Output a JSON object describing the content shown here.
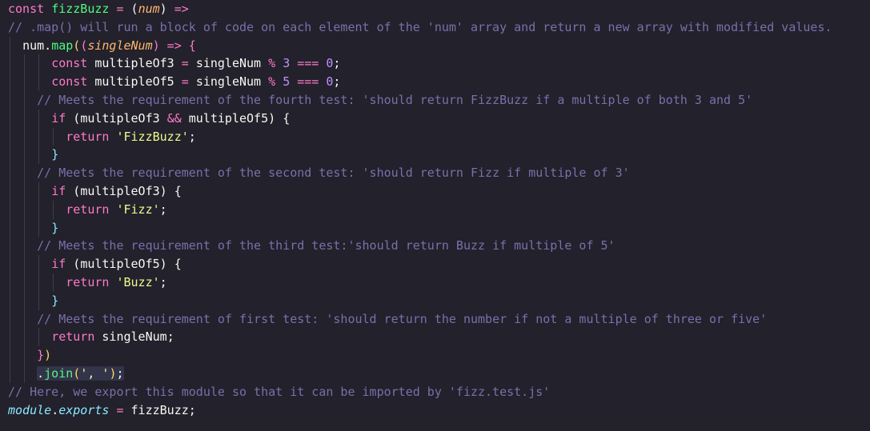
{
  "lines": [
    {
      "indent": 0,
      "guides": [],
      "tokens": [
        {
          "t": "const ",
          "c": "kw"
        },
        {
          "t": "fizzBuzz",
          "c": "fn"
        },
        {
          "t": " = ",
          "c": "op"
        },
        {
          "t": "(",
          "c": "punc"
        },
        {
          "t": "num",
          "c": "param"
        },
        {
          "t": ") ",
          "c": "punc"
        },
        {
          "t": "=>",
          "c": "op"
        }
      ]
    },
    {
      "indent": 0,
      "guides": [],
      "tokens": [
        {
          "t": "// .map() will run a block of code on each element of the 'num' array and return a new array with modified values.",
          "c": "cm"
        }
      ]
    },
    {
      "indent": 2,
      "guides": [
        0
      ],
      "tokens": [
        {
          "t": "num",
          "c": "var"
        },
        {
          "t": ".",
          "c": "punc"
        },
        {
          "t": "map",
          "c": "fn"
        },
        {
          "t": "(",
          "c": "brace-gold"
        },
        {
          "t": "(",
          "c": "brace-pink"
        },
        {
          "t": "singleNum",
          "c": "param"
        },
        {
          "t": ")",
          "c": "brace-pink"
        },
        {
          "t": " => ",
          "c": "op"
        },
        {
          "t": "{",
          "c": "brace-pink"
        }
      ]
    },
    {
      "indent": 6,
      "guides": [
        0,
        2,
        4
      ],
      "tokens": [
        {
          "t": "const ",
          "c": "kw"
        },
        {
          "t": "multipleOf3",
          "c": "var"
        },
        {
          "t": " = ",
          "c": "op"
        },
        {
          "t": "singleNum ",
          "c": "var"
        },
        {
          "t": "% ",
          "c": "op"
        },
        {
          "t": "3",
          "c": "num"
        },
        {
          "t": " === ",
          "c": "op"
        },
        {
          "t": "0",
          "c": "num"
        },
        {
          "t": ";",
          "c": "punc"
        }
      ]
    },
    {
      "indent": 6,
      "guides": [
        0,
        2,
        4
      ],
      "tokens": [
        {
          "t": "const ",
          "c": "kw"
        },
        {
          "t": "multipleOf5",
          "c": "var"
        },
        {
          "t": " = ",
          "c": "op"
        },
        {
          "t": "singleNum ",
          "c": "var"
        },
        {
          "t": "% ",
          "c": "op"
        },
        {
          "t": "5",
          "c": "num"
        },
        {
          "t": " === ",
          "c": "op"
        },
        {
          "t": "0",
          "c": "num"
        },
        {
          "t": ";",
          "c": "punc"
        }
      ]
    },
    {
      "indent": 4,
      "guides": [
        0,
        2
      ],
      "tokens": [
        {
          "t": "// Meets the requirement of the fourth test: 'should return FizzBuzz if a multiple of both 3 and 5'",
          "c": "cm"
        }
      ]
    },
    {
      "indent": 6,
      "guides": [
        0,
        2,
        4
      ],
      "tokens": [
        {
          "t": "if ",
          "c": "kw"
        },
        {
          "t": "(",
          "c": "punc"
        },
        {
          "t": "multipleOf3 ",
          "c": "var"
        },
        {
          "t": "&& ",
          "c": "op"
        },
        {
          "t": "multipleOf5",
          "c": "var"
        },
        {
          "t": ") ",
          "c": "punc"
        },
        {
          "t": "{",
          "c": "punc"
        }
      ]
    },
    {
      "indent": 8,
      "guides": [
        0,
        2,
        4,
        6
      ],
      "tokens": [
        {
          "t": "return ",
          "c": "kw"
        },
        {
          "t": "'FizzBuzz'",
          "c": "str"
        },
        {
          "t": ";",
          "c": "punc"
        }
      ]
    },
    {
      "indent": 6,
      "guides": [
        0,
        2,
        4
      ],
      "tokens": [
        {
          "t": "}",
          "c": "brace-blue"
        }
      ]
    },
    {
      "indent": 4,
      "guides": [
        0,
        2
      ],
      "tokens": [
        {
          "t": "// Meets the requirement of the second test: 'should return Fizz if multiple of 3'",
          "c": "cm"
        }
      ]
    },
    {
      "indent": 6,
      "guides": [
        0,
        2,
        4
      ],
      "tokens": [
        {
          "t": "if ",
          "c": "kw"
        },
        {
          "t": "(",
          "c": "punc"
        },
        {
          "t": "multipleOf3",
          "c": "var"
        },
        {
          "t": ") ",
          "c": "punc"
        },
        {
          "t": "{",
          "c": "punc"
        }
      ]
    },
    {
      "indent": 8,
      "guides": [
        0,
        2,
        4,
        6
      ],
      "tokens": [
        {
          "t": "return ",
          "c": "kw"
        },
        {
          "t": "'Fizz'",
          "c": "str"
        },
        {
          "t": ";",
          "c": "punc"
        }
      ]
    },
    {
      "indent": 6,
      "guides": [
        0,
        2,
        4
      ],
      "tokens": [
        {
          "t": "}",
          "c": "brace-blue"
        }
      ]
    },
    {
      "indent": 4,
      "guides": [
        0,
        2
      ],
      "tokens": [
        {
          "t": "// Meets the requirement of the third test:'should return Buzz if multiple of 5'",
          "c": "cm"
        }
      ]
    },
    {
      "indent": 6,
      "guides": [
        0,
        2,
        4
      ],
      "tokens": [
        {
          "t": "if ",
          "c": "kw"
        },
        {
          "t": "(",
          "c": "punc"
        },
        {
          "t": "multipleOf5",
          "c": "var"
        },
        {
          "t": ") ",
          "c": "punc"
        },
        {
          "t": "{",
          "c": "punc"
        }
      ]
    },
    {
      "indent": 8,
      "guides": [
        0,
        2,
        4,
        6
      ],
      "tokens": [
        {
          "t": "return ",
          "c": "kw"
        },
        {
          "t": "'Buzz'",
          "c": "str"
        },
        {
          "t": ";",
          "c": "punc"
        }
      ]
    },
    {
      "indent": 6,
      "guides": [
        0,
        2,
        4
      ],
      "tokens": [
        {
          "t": "}",
          "c": "brace-blue"
        }
      ]
    },
    {
      "indent": 4,
      "guides": [
        0,
        2
      ],
      "tokens": [
        {
          "t": "// Meets the requirement of first test: 'should return the number if not a multiple of three or five'",
          "c": "cm"
        }
      ]
    },
    {
      "indent": 6,
      "guides": [
        0,
        2,
        4
      ],
      "tokens": [
        {
          "t": "return ",
          "c": "kw"
        },
        {
          "t": "singleNum",
          "c": "var"
        },
        {
          "t": ";",
          "c": "punc"
        }
      ]
    },
    {
      "indent": 4,
      "guides": [
        0,
        2
      ],
      "tokens": [
        {
          "t": "}",
          "c": "brace-pink"
        },
        {
          "t": ")",
          "c": "brace-gold"
        }
      ]
    },
    {
      "indent": 4,
      "guides": [
        0,
        2
      ],
      "highlight": true,
      "tokens": [
        {
          "t": ".",
          "c": "punc"
        },
        {
          "t": "join",
          "c": "fn"
        },
        {
          "t": "(",
          "c": "brace-gold"
        },
        {
          "t": "', '",
          "c": "str"
        },
        {
          "t": ")",
          "c": "brace-gold"
        },
        {
          "t": ";",
          "c": "punc"
        }
      ]
    },
    {
      "indent": 0,
      "guides": [],
      "tokens": [
        {
          "t": "// Here, we export this module so that it can be imported by 'fizz.test.js'",
          "c": "cm"
        }
      ]
    },
    {
      "indent": 0,
      "guides": [],
      "tokens": [
        {
          "t": "module",
          "c": "mod"
        },
        {
          "t": ".",
          "c": "punc"
        },
        {
          "t": "exports",
          "c": "mod"
        },
        {
          "t": " = ",
          "c": "op"
        },
        {
          "t": "fizzBuzz",
          "c": "var"
        },
        {
          "t": ";",
          "c": "punc"
        }
      ]
    }
  ]
}
